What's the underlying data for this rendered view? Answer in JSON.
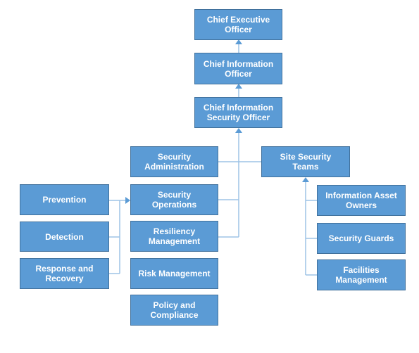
{
  "diagram": {
    "type": "org-chart",
    "colors": {
      "box_fill": "#5b9bd5",
      "box_border": "#41719c",
      "connector": "#9dc3e6",
      "text": "#ffffff"
    },
    "nodes": {
      "ceo": "Chief Executive\nOfficer",
      "cio": "Chief Information\nOfficer",
      "ciso": "Chief Information\nSecurity Officer",
      "security_administration": "Security\nAdministration",
      "security_operations": "Security\nOperations",
      "resiliency_management": "Resiliency\nManagement",
      "risk_management": "Risk Management",
      "policy_and_compliance": "Policy and\nCompliance",
      "prevention": "Prevention",
      "detection": "Detection",
      "response_and_recovery": "Response and\nRecovery",
      "site_security_teams": "Site Security\nTeams",
      "information_asset_owners": "Information Asset\nOwners",
      "security_guards": "Security Guards",
      "facilities_management": "Facilities\nManagement"
    },
    "edges": [
      {
        "from": "cio",
        "to": "ceo"
      },
      {
        "from": "ciso",
        "to": "cio"
      },
      {
        "from": "security_administration",
        "to": "ciso"
      },
      {
        "from": "security_operations",
        "to": "ciso"
      },
      {
        "from": "resiliency_management",
        "to": "ciso"
      },
      {
        "from": "site_security_teams",
        "to": "ciso"
      },
      {
        "from": "prevention",
        "to": "security_operations"
      },
      {
        "from": "detection",
        "to": "security_operations"
      },
      {
        "from": "response_and_recovery",
        "to": "security_operations"
      },
      {
        "from": "information_asset_owners",
        "to": "site_security_teams"
      },
      {
        "from": "security_guards",
        "to": "site_security_teams"
      },
      {
        "from": "facilities_management",
        "to": "site_security_teams"
      }
    ]
  }
}
